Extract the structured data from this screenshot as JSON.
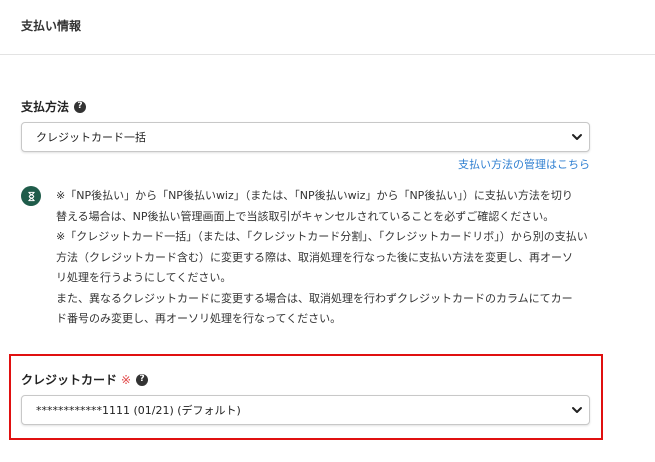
{
  "header": {
    "title": "支払い情報"
  },
  "payment_method": {
    "label": "支払方法",
    "selected": "クレジットカード一括",
    "manage_link": "支払い方法の管理はこちら"
  },
  "notice": {
    "lines": [
      "※「NP後払い」から「NP後払いwiz」（または、「NP後払いwiz」から「NP後払い」）に支払い方法を切り",
      "替える場合は、NP後払い管理画面上で当該取引がキャンセルされていることを必ずご確認ください。",
      "※「クレジットカード一括」（または、「クレジットカード分割」、「クレジットカードリボ」）から別の支払い",
      "方法（クレジットカード含む）に変更する際は、取消処理を行なった後に支払い方法を変更し、再オーソ",
      "リ処理を行うようにしてください。",
      "また、異なるクレジットカードに変更する場合は、取消処理を行わずクレジットカードのカラムにてカー",
      "ド番号のみ変更し、再オーソリ処理を行なってください。"
    ]
  },
  "credit_card": {
    "label": "クレジットカード",
    "required_mark": "※",
    "selected": "************1111 (01/21) (デフォルト)"
  },
  "colors": {
    "link": "#2f7fd1",
    "notice_icon_bg": "#1f5c4a",
    "highlight_border": "#e01010",
    "required": "#e24a4a"
  }
}
